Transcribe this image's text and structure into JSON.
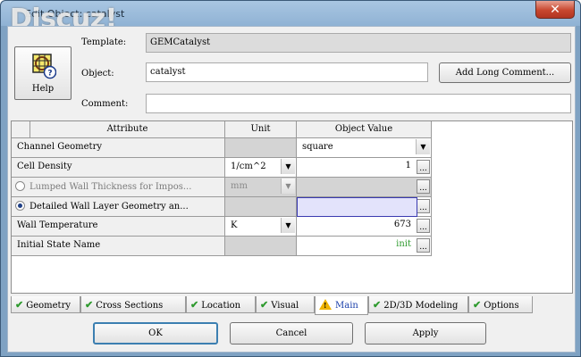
{
  "window": {
    "title": "Edit Object: catalyst",
    "watermark": "Discuz!",
    "close_glyph": "✕"
  },
  "form": {
    "help_label": "Help",
    "template_label": "Template:",
    "template_value": "GEMCatalyst",
    "object_label": "Object:",
    "object_value": "catalyst",
    "comment_label": "Comment:",
    "comment_value": "",
    "add_long_comment_label": "Add Long Comment..."
  },
  "table": {
    "headers": {
      "attribute": "Attribute",
      "unit": "Unit",
      "value": "Object Value"
    },
    "rows": [
      {
        "attribute": "Channel Geometry",
        "unit": "",
        "value": "square"
      },
      {
        "attribute": "Cell Density",
        "unit": "1/cm^2",
        "value": "1"
      },
      {
        "attribute": "Lumped Wall Thickness for Impos...",
        "unit": "mm",
        "value": ""
      },
      {
        "attribute": "Detailed Wall Layer Geometry an...",
        "unit": "",
        "value": ""
      },
      {
        "attribute": "Wall Temperature",
        "unit": "K",
        "value": "673"
      },
      {
        "attribute": "Initial State Name",
        "unit": "",
        "value": "init"
      }
    ],
    "dots": "..."
  },
  "tabs": [
    {
      "label": "Geometry",
      "state": "ok"
    },
    {
      "label": "Cross Sections",
      "state": "ok"
    },
    {
      "label": "Location",
      "state": "ok"
    },
    {
      "label": "Visual",
      "state": "ok"
    },
    {
      "label": "Main",
      "state": "warning",
      "active": true
    },
    {
      "label": "2D/3D Modeling",
      "state": "ok"
    },
    {
      "label": "Options",
      "state": "ok"
    }
  ],
  "buttons": {
    "ok": "OK",
    "cancel": "Cancel",
    "apply": "Apply"
  },
  "colors": {
    "check": "#2e9a2e",
    "warning": "#f0b400",
    "init_text": "#2e9a2e",
    "selection": "#e3e3fb",
    "close_button": "#c8472f"
  },
  "icons": {
    "check": "✔",
    "dropdown": "▼",
    "warning_mark": "!"
  }
}
